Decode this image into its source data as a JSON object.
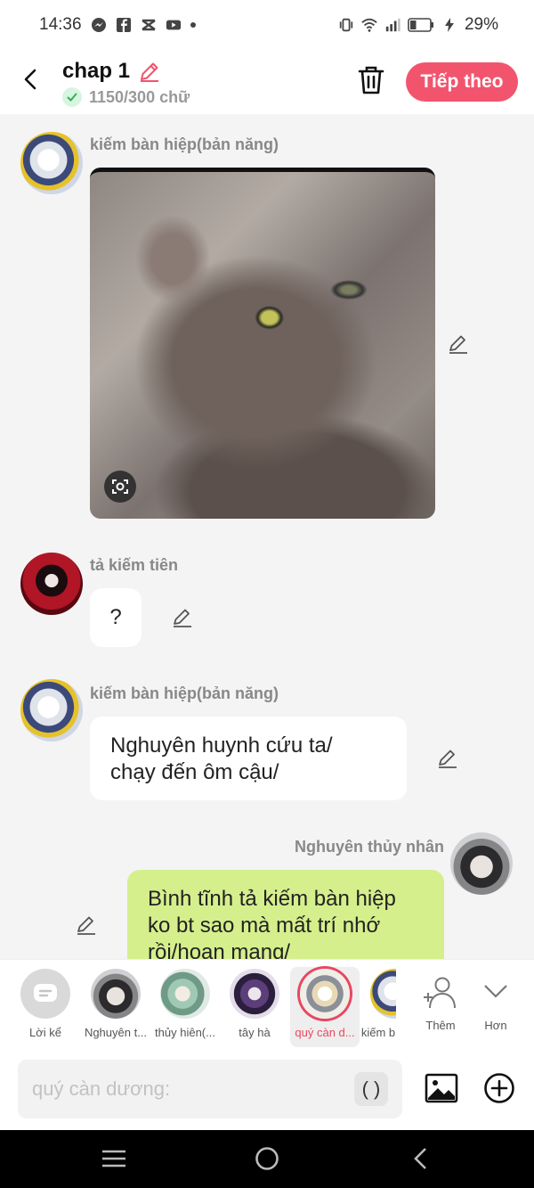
{
  "status_bar": {
    "time": "14:36",
    "battery": "29%"
  },
  "header": {
    "title": "chap 1",
    "word_count": "1150/300 chữ",
    "next_label": "Tiếp theo"
  },
  "messages": [
    {
      "sender": "kiếm bàn hiệp(bản năng)",
      "type": "image"
    },
    {
      "sender": "tả kiếm tiên",
      "text": "?"
    },
    {
      "sender": "kiếm bàn hiệp(bản năng)",
      "line1": "Nghuyên huynh cứu ta/",
      "line2": "chạy đến ôm cậu/"
    },
    {
      "sender": "Nghuyên thủy nhân",
      "line1": "Bình tĩnh tả kiếm bàn hiệp",
      "line2": "ko bt sao mà mất trí nhớ",
      "line3": "rồi/hoan mang/"
    }
  ],
  "characters": [
    {
      "label": "Lời kể"
    },
    {
      "label": "Nghuyên t..."
    },
    {
      "label": "thủy hiên(..."
    },
    {
      "label": "tây hà"
    },
    {
      "label": "quý càn d..."
    },
    {
      "label": "kiếm b"
    },
    {
      "label": "Thêm"
    },
    {
      "label": "Hơn"
    }
  ],
  "input": {
    "placeholder": "quý càn dương:",
    "paren": "( )"
  },
  "colors": {
    "accent": "#f2546e",
    "green_bubble": "#d5ef8c"
  }
}
